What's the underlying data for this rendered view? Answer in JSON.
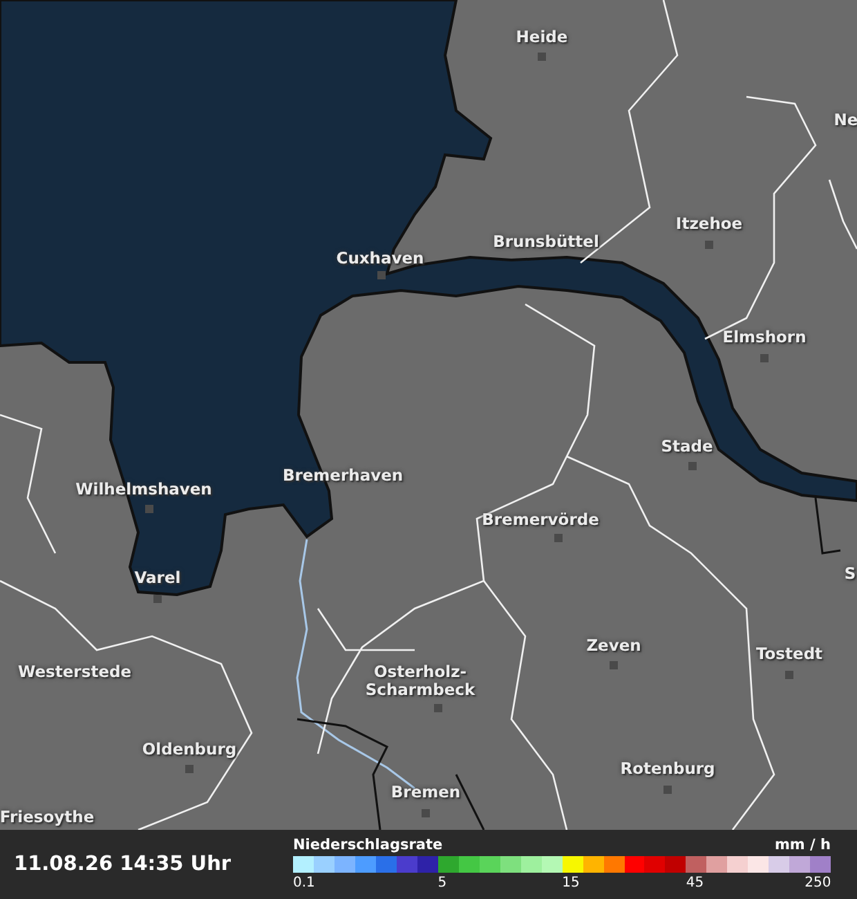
{
  "cities": [
    {
      "name": "Heide"
    },
    {
      "name": "Ne"
    },
    {
      "name": "Itzehoe"
    },
    {
      "name": "Cuxhaven"
    },
    {
      "name": "Brunsbüttel"
    },
    {
      "name": "Elmshorn"
    },
    {
      "name": "Stade"
    },
    {
      "name": "Wilhelmshaven"
    },
    {
      "name": "Bremerhaven"
    },
    {
      "name": "Bremervörde"
    },
    {
      "name": "Varel"
    },
    {
      "name": "S"
    },
    {
      "name": "Zeven"
    },
    {
      "name": "Tostedt"
    },
    {
      "name": "Westerstede"
    },
    {
      "name": "Osterholz-Scharmbeck"
    },
    {
      "name": "Oldenburg"
    },
    {
      "name": "Rotenburg"
    },
    {
      "name": "Bremen"
    },
    {
      "name": "Friesoythe"
    }
  ],
  "timestamp": "11.08.26 14:35 Uhr",
  "legend": {
    "title": "Niederschlagsrate",
    "unit": "mm / h",
    "swatches": [
      {
        "color": "#b3f0ff",
        "label": "0.1"
      },
      {
        "color": "#9ad0ff"
      },
      {
        "color": "#7cb4ff"
      },
      {
        "color": "#4d9cff"
      },
      {
        "color": "#2a6fe8"
      },
      {
        "color": "#4b3ccc"
      },
      {
        "color": "#2e22a8"
      },
      {
        "color": "#2ea82e",
        "label": "5"
      },
      {
        "color": "#44c744"
      },
      {
        "color": "#5ad45a"
      },
      {
        "color": "#7ee07e"
      },
      {
        "color": "#9ef09e"
      },
      {
        "color": "#b4f8b4"
      },
      {
        "color": "#f7f700",
        "label": "15"
      },
      {
        "color": "#ffb400"
      },
      {
        "color": "#ff7800"
      },
      {
        "color": "#ff0000"
      },
      {
        "color": "#e00000"
      },
      {
        "color": "#c00000"
      },
      {
        "color": "#c06060",
        "label": "45"
      },
      {
        "color": "#e0a0a0"
      },
      {
        "color": "#f5d0d0"
      },
      {
        "color": "#fbe6e6"
      },
      {
        "color": "#d8cce8"
      },
      {
        "color": "#c0a8d8"
      },
      {
        "color": "#a080c8",
        "label": "250"
      }
    ]
  }
}
